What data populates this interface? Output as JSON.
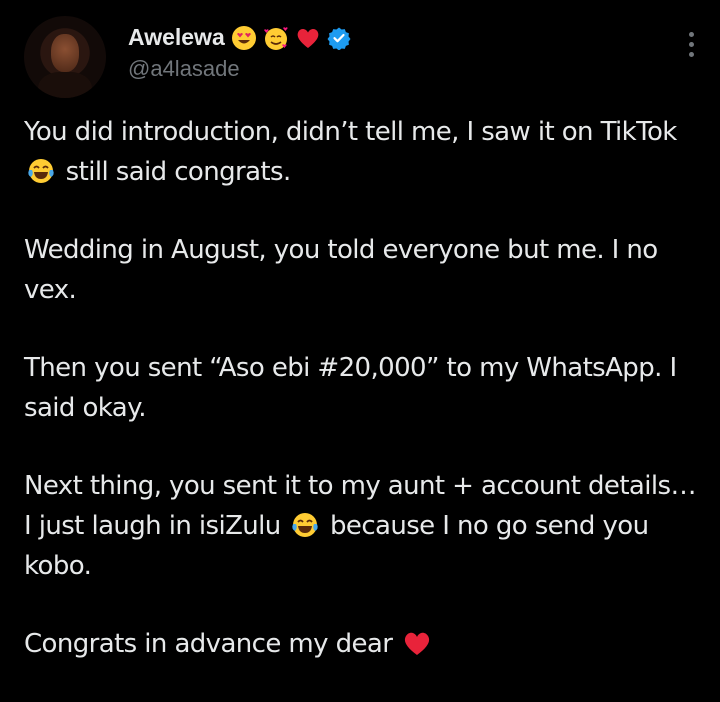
{
  "user": {
    "display_name": "Awelewa",
    "handle": "@a4lasade",
    "badges": [
      "heart-eyes-emoji",
      "smiling-face-with-hearts-emoji",
      "red-heart-emoji"
    ],
    "verified": true
  },
  "colors": {
    "background": "#000000",
    "text": "#e7e9ea",
    "muted": "#71767b",
    "verified_blue": "#1d9bf0",
    "heart_red": "#f91880"
  },
  "tweet": {
    "p1": "You did introduction, didn’t tell me, I saw it on TikTok",
    "p1_tail": "still said congrats.",
    "p2": "Wedding in August, you told everyone but me. I no vex.",
    "p3": "Then you sent “Aso ebi #20,000” to my WhatsApp. I said okay.",
    "p4": "Next thing, you sent it to my aunt + account details… I just laugh in isiZulu",
    "p4_tail": "because I no go send you kobo.",
    "p5": "Congrats in advance my dear"
  }
}
